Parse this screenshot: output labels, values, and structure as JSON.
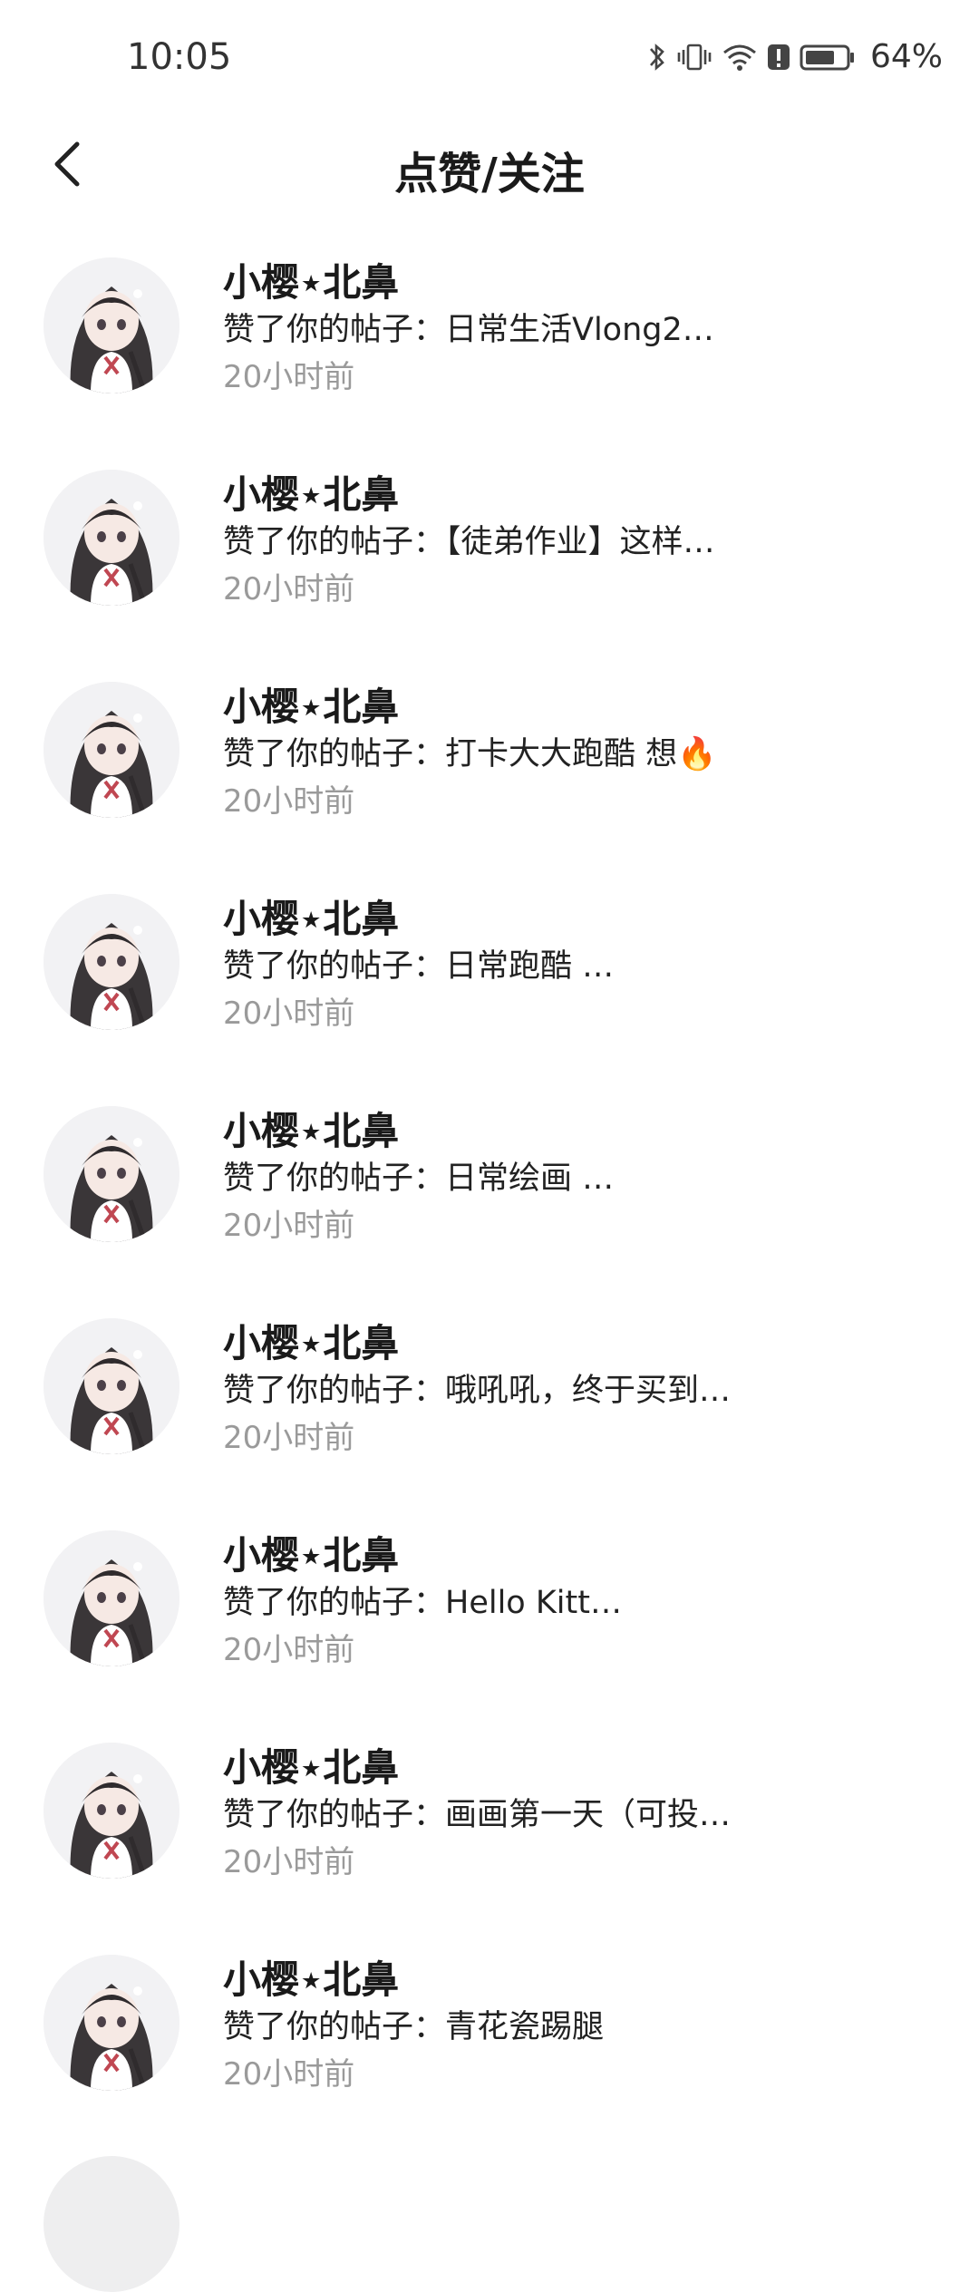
{
  "status_bar": {
    "time": "10:05",
    "battery": "64%",
    "icons": [
      "bluetooth-icon",
      "vibrate-icon",
      "wifi-icon",
      "alert-icon",
      "battery-icon"
    ]
  },
  "header": {
    "title": "点赞/关注",
    "back_icon": "chevron-left-icon"
  },
  "notifications": [
    {
      "user": "小樱⋆北鼻",
      "action": "赞了你的帖子：日常生活Vlong2…",
      "time": "20小时前"
    },
    {
      "user": "小樱⋆北鼻",
      "action": "赞了你的帖子：【徒弟作业】这样…",
      "time": "20小时前"
    },
    {
      "user": "小樱⋆北鼻",
      "action": "赞了你的帖子：打卡大大跑酷 想🔥",
      "time": "20小时前"
    },
    {
      "user": "小樱⋆北鼻",
      "action": "赞了你的帖子：日常跑酷      …",
      "time": "20小时前"
    },
    {
      "user": "小樱⋆北鼻",
      "action": "赞了你的帖子：日常绘画      …",
      "time": "20小时前"
    },
    {
      "user": "小樱⋆北鼻",
      "action": "赞了你的帖子：哦吼吼，终于买到…",
      "time": "20小时前"
    },
    {
      "user": "小樱⋆北鼻",
      "action": "赞了你的帖子：Hello Kitt…",
      "time": "20小时前"
    },
    {
      "user": "小樱⋆北鼻",
      "action": "赞了你的帖子：画画第一天（可投…",
      "time": "20小时前"
    },
    {
      "user": "小樱⋆北鼻",
      "action": "赞了你的帖子：青花瓷踢腿",
      "time": "20小时前"
    }
  ]
}
